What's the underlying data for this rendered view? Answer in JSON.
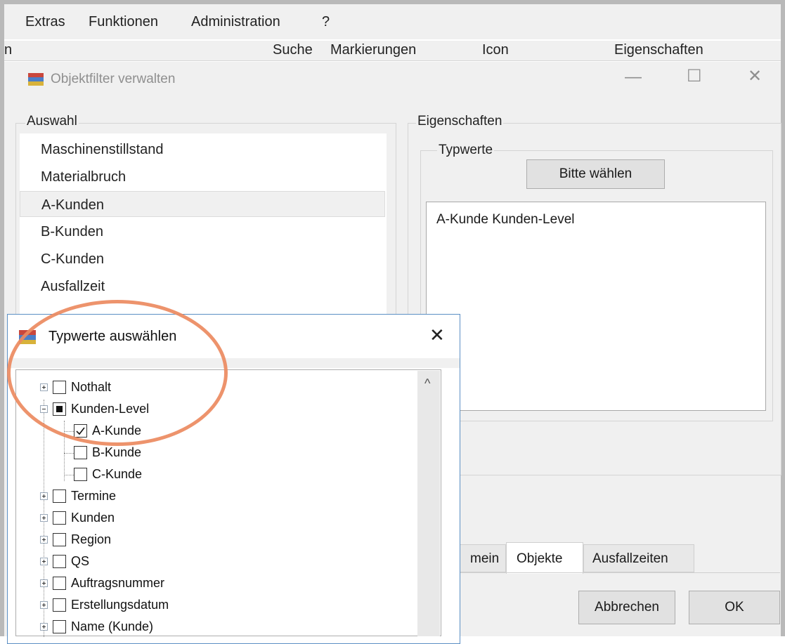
{
  "menu": [
    "Extras",
    "Funktionen",
    "Administration",
    "?"
  ],
  "column_headers": {
    "left_fragment": "n",
    "suche": "Suche",
    "markierungen": "Markierungen",
    "icon": "Icon",
    "eigenschaften": "Eigenschaften"
  },
  "dialog": {
    "title": "Objektfilter verwalten",
    "minimize": "—",
    "maximize": "☐",
    "close": "✕",
    "auswahl_label": "Auswahl",
    "eigenschaften_label": "Eigenschaften",
    "typwerte_label": "Typwerte",
    "bitte_waehlen": "Bitte wählen",
    "textbox_value": "A-Kunde  Kunden-Level",
    "list_items": [
      "Maschinenstillstand",
      "Materialbruch",
      "A-Kunden",
      "B-Kunden",
      "C-Kunden",
      "Ausfallzeit"
    ],
    "selected_index": 2,
    "tabs": [
      "mein",
      "Objekte",
      "Ausfallzeiten"
    ],
    "active_tab": 1,
    "cancel": "Abbrechen",
    "ok": "OK"
  },
  "subdialog": {
    "title": "Typwerte auswählen",
    "close": "✕",
    "scroll_up": "^",
    "tree": [
      {
        "label": "Nothalt",
        "level": 0,
        "expander": "closed",
        "check": "unchecked"
      },
      {
        "label": "Kunden-Level",
        "level": 0,
        "expander": "open",
        "check": "partial"
      },
      {
        "label": "A-Kunde",
        "level": 1,
        "expander": "none",
        "check": "checked"
      },
      {
        "label": "B-Kunde",
        "level": 1,
        "expander": "none",
        "check": "unchecked"
      },
      {
        "label": "C-Kunde",
        "level": 1,
        "expander": "none",
        "check": "unchecked"
      },
      {
        "label": "Termine",
        "level": 0,
        "expander": "closed",
        "check": "unchecked"
      },
      {
        "label": "Kunden",
        "level": 0,
        "expander": "closed",
        "check": "unchecked"
      },
      {
        "label": "Region",
        "level": 0,
        "expander": "closed",
        "check": "unchecked"
      },
      {
        "label": "QS",
        "level": 0,
        "expander": "closed",
        "check": "unchecked"
      },
      {
        "label": "Auftragsnummer",
        "level": 0,
        "expander": "closed",
        "check": "unchecked"
      },
      {
        "label": "Erstellungsdatum",
        "level": 0,
        "expander": "closed",
        "check": "unchecked"
      },
      {
        "label": "Name (Kunde)",
        "level": 0,
        "expander": "closed",
        "check": "unchecked"
      }
    ]
  },
  "colors": {
    "highlight_ring": "#ec8a5f",
    "subdialog_border": "#5b8fc4",
    "chrome_bg": "#f0f0f0"
  }
}
